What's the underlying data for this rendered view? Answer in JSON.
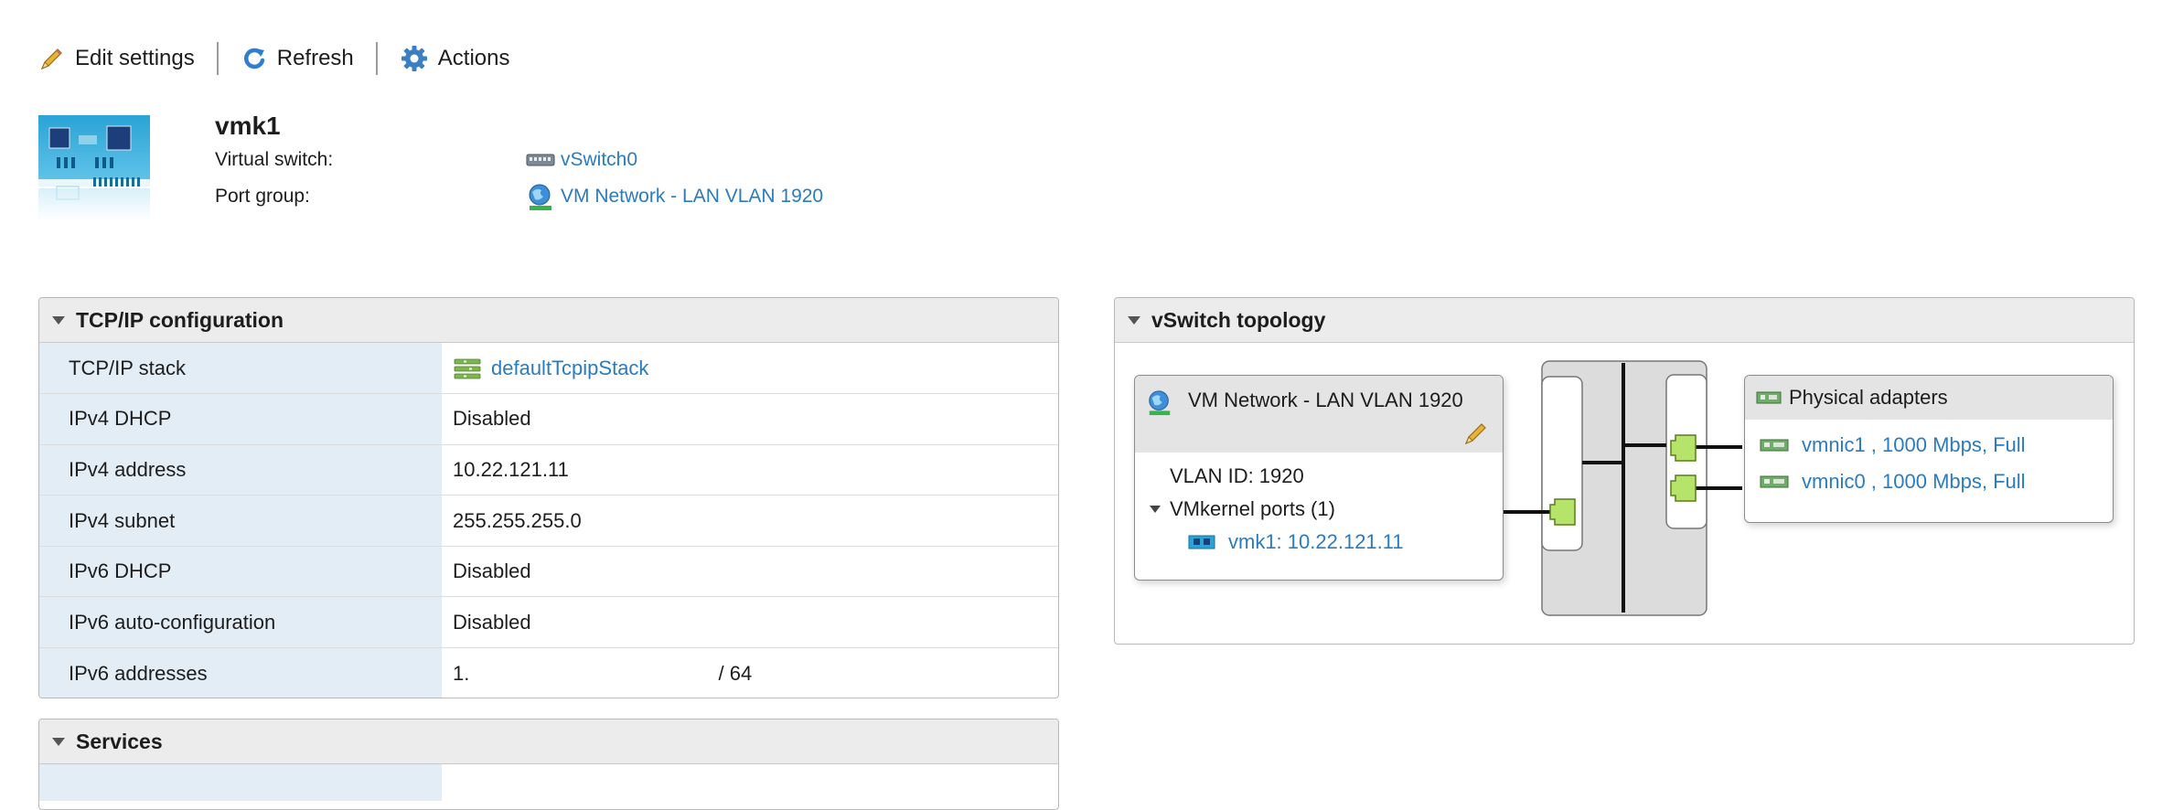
{
  "toolbar": {
    "edit_label": "Edit settings",
    "refresh_label": "Refresh",
    "actions_label": "Actions"
  },
  "header": {
    "title": "vmk1",
    "virtual_switch_label": "Virtual switch:",
    "virtual_switch_value": "vSwitch0",
    "port_group_label": "Port group:",
    "port_group_value": "VM Network - LAN VLAN 1920"
  },
  "tcpip": {
    "title": "TCP/IP configuration",
    "rows": [
      {
        "key": "TCP/IP stack",
        "value": "defaultTcpipStack"
      },
      {
        "key": "IPv4 DHCP",
        "value": "Disabled"
      },
      {
        "key": "IPv4 address",
        "value": "10.22.121.11"
      },
      {
        "key": "IPv4 subnet",
        "value": "255.255.255.0"
      },
      {
        "key": "IPv6 DHCP",
        "value": "Disabled"
      },
      {
        "key": "IPv6 auto-configuration",
        "value": "Disabled"
      },
      {
        "key": "IPv6 addresses",
        "value": "1.",
        "suffix": "/ 64"
      }
    ]
  },
  "services": {
    "title": "Services"
  },
  "topology": {
    "title": "vSwitch topology",
    "port_group": {
      "name": "VM Network - LAN VLAN 1920",
      "vlan": "VLAN ID: 1920",
      "vmkernel_ports": "VMkernel ports (1)",
      "vmk": "vmk1: 10.22.121.11"
    },
    "physical": {
      "title": "Physical adapters",
      "adapters": [
        "vmnic1 , 1000 Mbps, Full",
        "vmnic0 , 1000 Mbps, Full"
      ]
    }
  },
  "colors": {
    "link": "#2a7bc0",
    "key_cell_bg": "#e3edf5",
    "port_green": "#b6e36a"
  }
}
